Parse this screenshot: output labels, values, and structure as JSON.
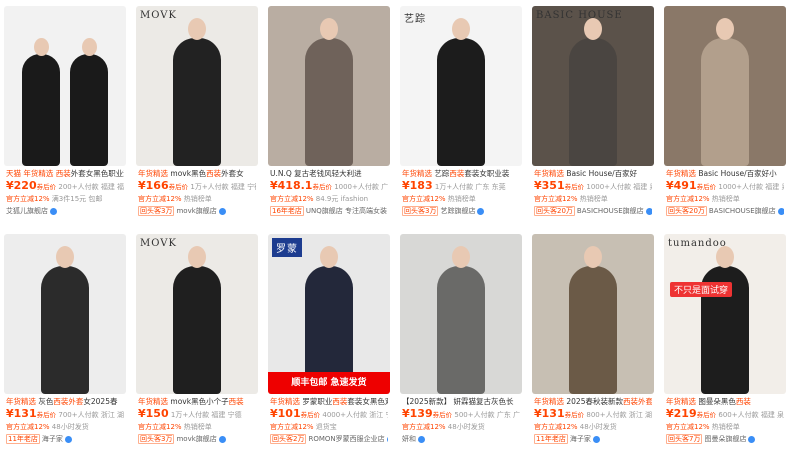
{
  "cards": [
    {
      "title_tag": "天猫 年货精选",
      "title_hl": "西装",
      "title_pre": "",
      "title_rest": "外套女黑色职业通",
      "price": "¥220",
      "price_tag": "券后价",
      "sold": "200+人付款",
      "location": "福建 福州",
      "meta1": "官方立减12%",
      "meta2": "满3件15元",
      "meta3": "包邮",
      "shop_tag": "",
      "shop": "艾狐儿旗舰店",
      "bg": "#f2f2f2",
      "suit": "#1a1a1a"
    },
    {
      "title_tag": "年货精选",
      "title_pre": "movk黑色",
      "title_hl": "西装",
      "title_rest": "外套女",
      "price": "¥166",
      "price_tag": "券后价",
      "sold": "1万+人付款",
      "location": "福建 宁德",
      "meta1": "官方立减12%",
      "meta2": "热销榜单",
      "meta3": "",
      "shop_tag": "回头客3万",
      "shop": "movk旗舰店",
      "brand": "MOVK",
      "bg": "#eceae6",
      "suit": "#222222"
    },
    {
      "title_tag": "",
      "title_pre": "U.N.Q 复古老钱风轻大利进",
      "title_hl": "",
      "title_rest": "",
      "price": "¥418.1",
      "price_tag": "券后价",
      "sold": "1000+人付款",
      "location": "广东",
      "meta1": "官方立减12%",
      "meta2": "84.9元",
      "meta3": "ifashion",
      "shop_tag": "16年老店",
      "shop": "UNQ旗舰店 专注高端女装",
      "bg": "#b9ada2",
      "suit": "#6f625a"
    },
    {
      "title_tag": "年货精选",
      "title_pre": "艺踪",
      "title_hl": "西装",
      "title_rest": "套装女职业装",
      "price": "¥183",
      "price_tag": "",
      "sold": "1万+人付款",
      "location": "广东 东莞",
      "meta1": "官方立减12%",
      "meta2": "热销榜单",
      "meta3": "",
      "shop_tag": "回头客3万",
      "shop": "艺踪旗舰店",
      "brand": "艺踪",
      "bg": "#f4f4f4",
      "suit": "#1c1c1c"
    },
    {
      "title_tag": "年货精选",
      "title_pre": "Basic House/百家好",
      "title_hl": "",
      "title_rest": "",
      "price": "¥351",
      "price_tag": "券后价",
      "sold": "1000+人付款",
      "location": "福建 泉州",
      "meta1": "官方立减12%",
      "meta2": "热销榜单",
      "meta3": "",
      "shop_tag": "回头客20万",
      "shop": "BASICHOUSE旗舰店",
      "brand": "BASIC HOUSE",
      "bg": "#5b524a",
      "suit": "#4a4541"
    },
    {
      "title_tag": "年货精选",
      "title_pre": "Basic House/百家好小",
      "title_hl": "",
      "title_rest": "",
      "price": "¥491",
      "price_tag": "券后价",
      "sold": "1000+人付款",
      "location": "福建 泉州",
      "meta1": "官方立减12%",
      "meta2": "热销榜单",
      "meta3": "",
      "shop_tag": "回头客20万",
      "shop": "BASICHOUSE旗舰店",
      "bg": "#8a7868",
      "suit": "#b29f8c"
    },
    {
      "title_tag": "年货精选",
      "title_pre": "灰色",
      "title_hl": "西装外套",
      "title_rest": "女2025春",
      "price": "¥131",
      "price_tag": "券后价",
      "sold": "700+人付款",
      "location": "浙江 湖州",
      "meta1": "官方立减12%",
      "meta2": "48小时发货",
      "meta3": "",
      "shop_tag": "11年老店",
      "shop": "海子家",
      "bg": "#ededed",
      "suit": "#2b2b2b"
    },
    {
      "title_tag": "年货精选",
      "title_pre": "movk黑色小个子",
      "title_hl": "西装",
      "title_rest": "",
      "price": "¥150",
      "price_tag": "",
      "sold": "1万+人付款",
      "location": "福建 宁德",
      "meta1": "官方立减12%",
      "meta2": "热销榜单",
      "meta3": "",
      "shop_tag": "回头客3万",
      "shop": "movk旗舰店",
      "brand": "MOVK",
      "bg": "#eceae6",
      "suit": "#1f1f1f"
    },
    {
      "title_tag": "年货精选",
      "title_pre": "罗蒙职业",
      "title_hl": "西装",
      "title_rest": "套装女黑色双",
      "price": "¥101",
      "price_tag": "券后价",
      "sold": "4000+人付款",
      "location": "浙江 宁波",
      "meta1": "官方立减12%",
      "meta2": "退货宝",
      "meta3": "",
      "shop_tag": "回头客2万",
      "shop": "ROMON罗蒙西服企业店",
      "brand": "罗蒙",
      "strip": "顺丰包邮  急速发货",
      "bg": "#e8e8e8",
      "suit": "#23283a"
    },
    {
      "title_tag": "",
      "title_pre": "【2025新款】 妍霖猫复古灰色长",
      "title_hl": "",
      "title_rest": "",
      "price": "¥139",
      "price_tag": "券后价",
      "sold": "500+人付款",
      "location": "广东 广州",
      "meta1": "官方立减12%",
      "meta2": "48小时发货",
      "meta3": "",
      "shop_tag": "",
      "shop": "妍和",
      "bg": "#d8d8d6",
      "suit": "#6a6a68"
    },
    {
      "title_tag": "年货精选",
      "title_pre": "2025春秋装新款",
      "title_hl": "西装外套",
      "title_rest": "",
      "price": "¥131",
      "price_tag": "券后价",
      "sold": "800+人付款",
      "location": "浙江 湖州",
      "meta1": "官方立减12%",
      "meta2": "48小时发货",
      "meta3": "",
      "shop_tag": "11年老店",
      "shop": "海子家",
      "bg": "#c7bfb3",
      "suit": "#6b5a47"
    },
    {
      "title_tag": "年货精选",
      "title_pre": "图曼朵黑色",
      "title_hl": "西装",
      "title_rest": "",
      "price": "¥219",
      "price_tag": "券后价",
      "sold": "600+人付款",
      "location": "福建 泉州",
      "meta1": "官方立减12%",
      "meta2": "热销榜单",
      "meta3": "",
      "shop_tag": "回头客7万",
      "shop": "图曼朵旗舰店",
      "brand": "tumandoo",
      "badge": "不只是面试穿",
      "bg": "#f2eee9",
      "suit": "#1d1d1d"
    }
  ],
  "colors": {
    "accent": "#ff4400",
    "muted": "#999999"
  }
}
